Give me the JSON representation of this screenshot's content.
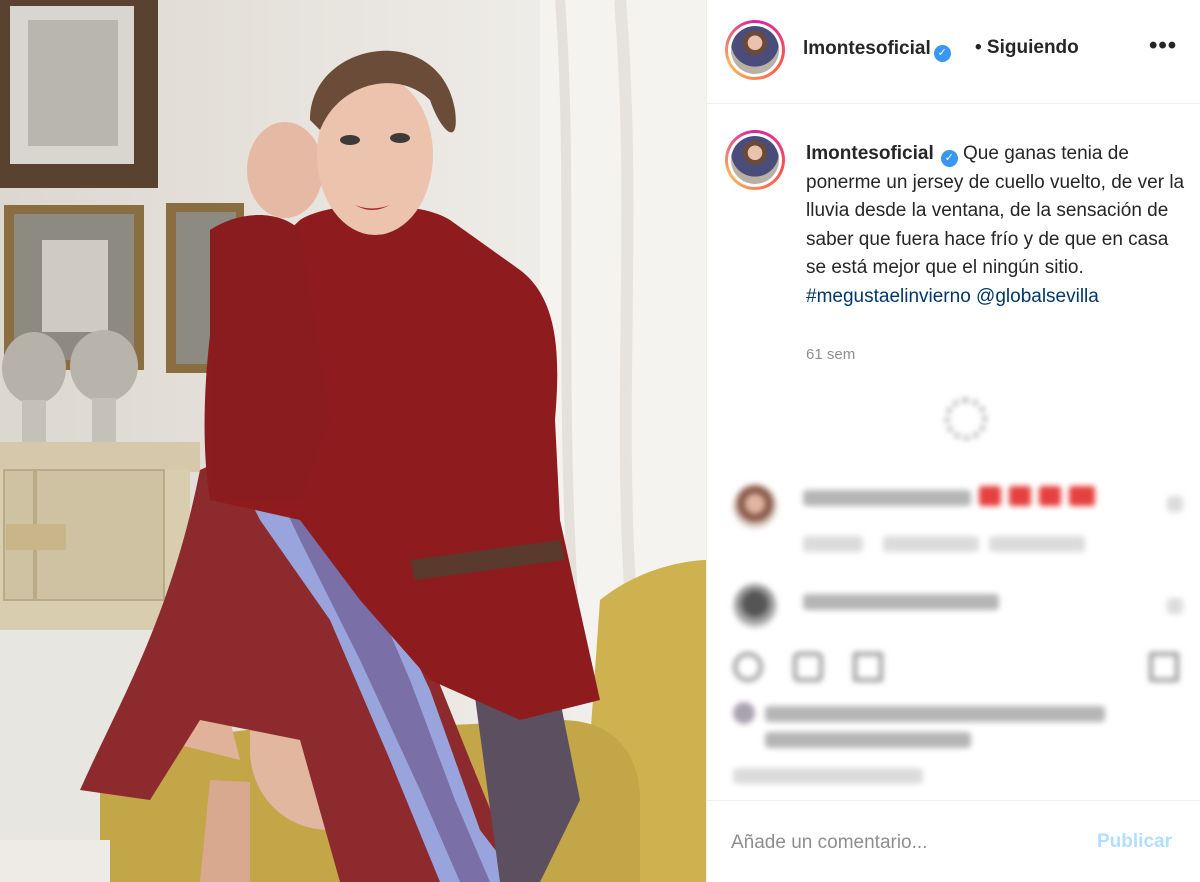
{
  "header": {
    "username": "lmontesoficial",
    "verified_icon": "verified-badge-icon",
    "follow_status": "• Siguiendo",
    "more_icon": "•••"
  },
  "caption": {
    "username": "lmontesoficial",
    "text": "Que ganas tenia de ponerme un jersey de cuello vuelto, de ver la lluvia desde la ventana, de la sensación de saber que fuera hace frío y de que en casa se está mejor que el ningún sitio.",
    "hashtag": "#megustaelinvierno",
    "mention": "@globalsevilla"
  },
  "post": {
    "time_ago": "61 sem"
  },
  "comment_box": {
    "placeholder": "Añade un comentario...",
    "publish_label": "Publicar"
  },
  "colors": {
    "accent_blue": "#3897f0",
    "link_blue": "#00376b",
    "publish_disabled": "#b2dffc",
    "sweater_red": "#8e1c1f"
  }
}
